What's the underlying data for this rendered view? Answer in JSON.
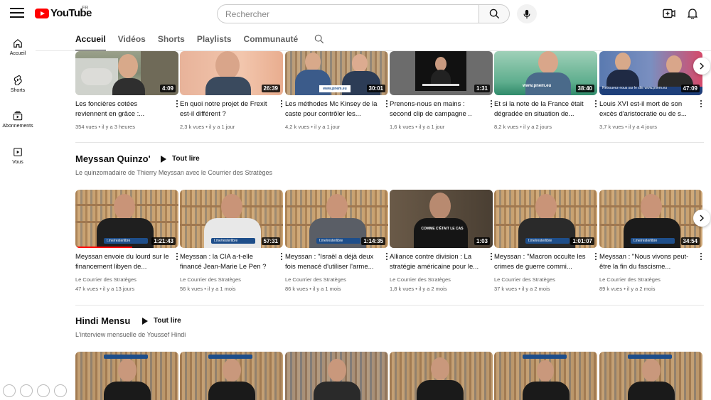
{
  "header": {
    "logo_text": "YouTube",
    "country": "FR",
    "search_placeholder": "Rechercher"
  },
  "sidebar": {
    "items": [
      {
        "label": "Accueil",
        "icon": "home-icon"
      },
      {
        "label": "Shorts",
        "icon": "shorts-icon"
      },
      {
        "label": "Abonnements",
        "icon": "subscriptions-icon"
      },
      {
        "label": "Vous",
        "icon": "you-icon"
      }
    ]
  },
  "tabs": [
    {
      "label": "Accueil",
      "active": true
    },
    {
      "label": "Vidéos",
      "active": false
    },
    {
      "label": "Shorts",
      "active": false
    },
    {
      "label": "Playlists",
      "active": false
    },
    {
      "label": "Communauté",
      "active": false
    }
  ],
  "shelves": [
    {
      "title": "",
      "videos": [
        {
          "title": "Les foncières cotées reviennent en grâce :...",
          "duration": "4:09",
          "views": "354 vues",
          "age": "il y a 3 heures"
        },
        {
          "title": "En quoi notre projet de Frexit est-il différent ?",
          "duration": "26:39",
          "views": "2,3 k vues",
          "age": "il y a 1 jour"
        },
        {
          "title": "Les méthodes Mc Kinsey de la caste pour contrôler les...",
          "duration": "30:01",
          "views": "4,2 k vues",
          "age": "il y a 1 jour"
        },
        {
          "title": "Prenons-nous en mains : second clip de campagne ..",
          "duration": "1:31",
          "views": "1,6 k vues",
          "age": "il y a 1 jour"
        },
        {
          "title": "Et si la note de la France était dégradée en situation de...",
          "duration": "38:40",
          "views": "8,2 k vues",
          "age": "il y a 2 jours"
        },
        {
          "title": "Louis XVI est-il mort de son excès d'aristocratie ou de s...",
          "duration": "47:09",
          "views": "3,7 k vues",
          "age": "il y a 4 jours"
        }
      ]
    },
    {
      "title": "Meyssan Quinzo'",
      "play_all": "Tout lire",
      "subtitle": "Le quinzomadaire de Thierry Meyssan avec le Courrier des Stratèges",
      "videos": [
        {
          "title": "Meyssan envoie du lourd sur le financement libyen de...",
          "duration": "1:21:43",
          "channel": "Le Courrier des Stratèges",
          "views": "47 k vues",
          "age": "il y a 13 jours",
          "progress": 0.55
        },
        {
          "title": "Meyssan : la CIA a-t-elle financé Jean-Marie Le Pen ?",
          "duration": "57:31",
          "channel": "Le Courrier des Stratèges",
          "views": "56 k vues",
          "age": "il y a 1 mois"
        },
        {
          "title": "Meyssan : \"Israël a déjà deux fois menacé d'utiliser l'arme...",
          "duration": "1:14:35",
          "channel": "Le Courrier des Stratèges",
          "views": "86 k vues",
          "age": "il y a 1 mois"
        },
        {
          "title": "Alliance contre division : La stratégie américaine pour le...",
          "duration": "1:03",
          "channel": "Le Courrier des Stratèges",
          "views": "1,8 k vues",
          "age": "il y a 2 mois"
        },
        {
          "title": "Meyssan : \"Macron occulte les crimes de guerre commi...",
          "duration": "1:01:07",
          "channel": "Le Courrier des Stratèges",
          "views": "37 k vues",
          "age": "il y a 2 mois"
        },
        {
          "title": "Meyssan : \"Nous vivons peut-être la fin du fascisme...",
          "duration": "34:54",
          "channel": "Le Courrier des Stratèges",
          "views": "89 k vues",
          "age": "il y a 2 mois"
        }
      ]
    },
    {
      "title": "Hindi Mensu",
      "play_all": "Tout lire",
      "subtitle": "L'interview mensuelle de Youssef Hindi"
    }
  ],
  "thumb_banners": {
    "shelf2": "t.me/resterlibre",
    "video4_caption": "COMME C'ÉTAIT LE CAS",
    "s1v6_caption": "Retrouvez-nous sur le site www.pnem.eu",
    "s1v5_caption": "www.pnem.eu",
    "s1v3_caption": "www.pnem.eu"
  },
  "colors": {
    "brand_red": "#ff0000",
    "text_primary": "#0f0f0f",
    "text_secondary": "#606060"
  }
}
